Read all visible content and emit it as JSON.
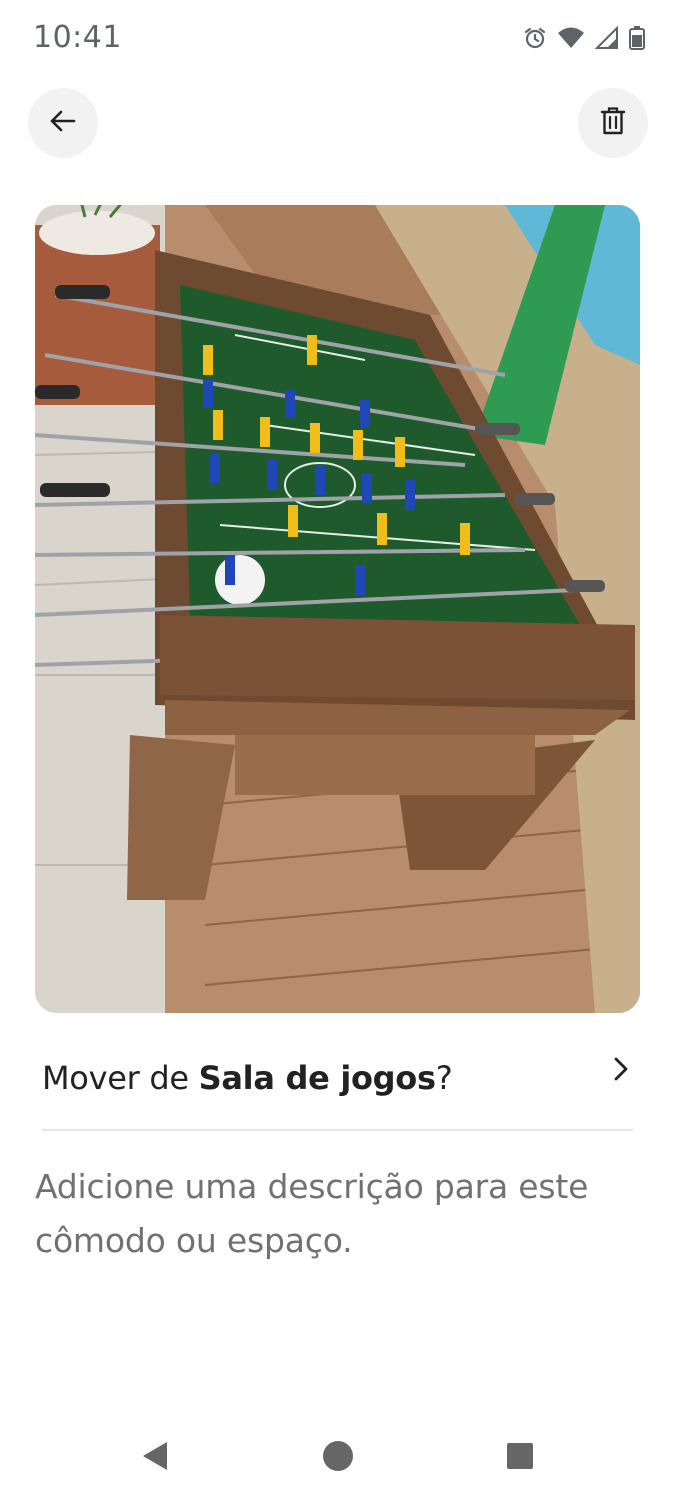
{
  "status_bar": {
    "time": "10:41",
    "icons": [
      "alarm-icon",
      "wifi-icon",
      "signal-icon",
      "battery-icon"
    ]
  },
  "header": {
    "back_icon": "arrow-left-icon",
    "delete_icon": "trash-icon"
  },
  "photo": {
    "subject": "foosball-table"
  },
  "move_row": {
    "prefix": "Mover de ",
    "room": "Sala de jogos",
    "suffix": "?",
    "icon": "chevron-right-icon"
  },
  "description": {
    "placeholder": "Adicione uma descrição para este cômodo ou espaço."
  },
  "nav_bar": {
    "icons": [
      "nav-back-icon",
      "nav-home-icon",
      "nav-recents-icon"
    ]
  },
  "colors": {
    "text_primary": "#222222",
    "text_secondary": "#717171",
    "button_bg": "#f2f2f2",
    "divider": "#e6e6e6"
  }
}
